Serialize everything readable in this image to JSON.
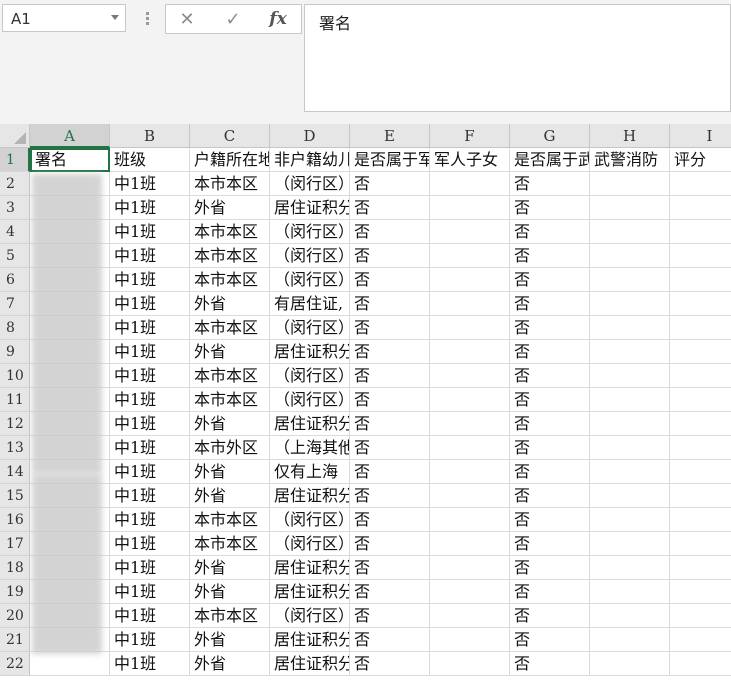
{
  "namebox": {
    "value": "A1"
  },
  "formula_bar": {
    "cancel_icon": "✕",
    "enter_icon": "✓",
    "fx_label": "fx",
    "content": "署名"
  },
  "columns": [
    "A",
    "B",
    "C",
    "D",
    "E",
    "F",
    "G",
    "H",
    "I"
  ],
  "rows": [
    "1",
    "2",
    "3",
    "4",
    "5",
    "6",
    "7",
    "8",
    "9",
    "10",
    "11",
    "12",
    "13",
    "14",
    "15",
    "16",
    "17",
    "18",
    "19",
    "20",
    "21",
    "22"
  ],
  "row_nums_visible": [
    "1",
    "2",
    "3",
    "4",
    "5",
    "6",
    "7",
    "8",
    "9",
    "10",
    "11",
    "12",
    "13",
    "14",
    "15",
    "16",
    "17",
    "18",
    "19",
    "20",
    "21",
    "22"
  ],
  "header_row": [
    "署名",
    "班级",
    "户籍所在地",
    "非户籍幼儿",
    "是否属于军",
    "军人子女",
    "是否属于武",
    "武警消防",
    "评分"
  ],
  "data_rows": [
    [
      "",
      "中1班",
      "本市本区",
      "（闵行区）",
      "否",
      "",
      "否",
      "",
      ""
    ],
    [
      "",
      "中1班",
      "外省",
      "居住证积分",
      "否",
      "",
      "否",
      "",
      ""
    ],
    [
      "",
      "中1班",
      "本市本区",
      "（闵行区）",
      "否",
      "",
      "否",
      "",
      ""
    ],
    [
      "",
      "中1班",
      "本市本区",
      "（闵行区）",
      "否",
      "",
      "否",
      "",
      ""
    ],
    [
      "",
      "中1班",
      "本市本区",
      "（闵行区）",
      "否",
      "",
      "否",
      "",
      ""
    ],
    [
      "",
      "中1班",
      "外省",
      "有居住证,",
      "否",
      "",
      "否",
      "",
      ""
    ],
    [
      "",
      "中1班",
      "本市本区",
      "（闵行区）",
      "否",
      "",
      "否",
      "",
      ""
    ],
    [
      "",
      "中1班",
      "外省",
      "居住证积分",
      "否",
      "",
      "否",
      "",
      ""
    ],
    [
      "",
      "中1班",
      "本市本区",
      "（闵行区）",
      "否",
      "",
      "否",
      "",
      ""
    ],
    [
      "",
      "中1班",
      "本市本区",
      "（闵行区）",
      "否",
      "",
      "否",
      "",
      ""
    ],
    [
      "",
      "中1班",
      "外省",
      "居住证积分",
      "否",
      "",
      "否",
      "",
      ""
    ],
    [
      "",
      "中1班",
      "本市外区",
      "（上海其他",
      "否",
      "",
      "否",
      "",
      ""
    ],
    [
      "",
      "中1班",
      "外省",
      "仅有上海",
      "否",
      "",
      "否",
      "",
      ""
    ],
    [
      "",
      "中1班",
      "外省",
      "居住证积分",
      "否",
      "",
      "否",
      "",
      ""
    ],
    [
      "",
      "中1班",
      "本市本区",
      "（闵行区）",
      "否",
      "",
      "否",
      "",
      ""
    ],
    [
      "",
      "中1班",
      "本市本区",
      "（闵行区）",
      "否",
      "",
      "否",
      "",
      ""
    ],
    [
      "",
      "中1班",
      "外省",
      "居住证积分",
      "否",
      "",
      "否",
      "",
      ""
    ],
    [
      "",
      "中1班",
      "外省",
      "居住证积分",
      "否",
      "",
      "否",
      "",
      ""
    ],
    [
      "",
      "中1班",
      "本市本区",
      "（闵行区）",
      "否",
      "",
      "否",
      "",
      ""
    ],
    [
      "",
      "中1班",
      "外省",
      "居住证积分",
      "否",
      "",
      "否",
      "",
      ""
    ],
    [
      "",
      "中1班",
      "外省",
      "居住证积分",
      "否",
      "",
      "否",
      "",
      ""
    ]
  ]
}
